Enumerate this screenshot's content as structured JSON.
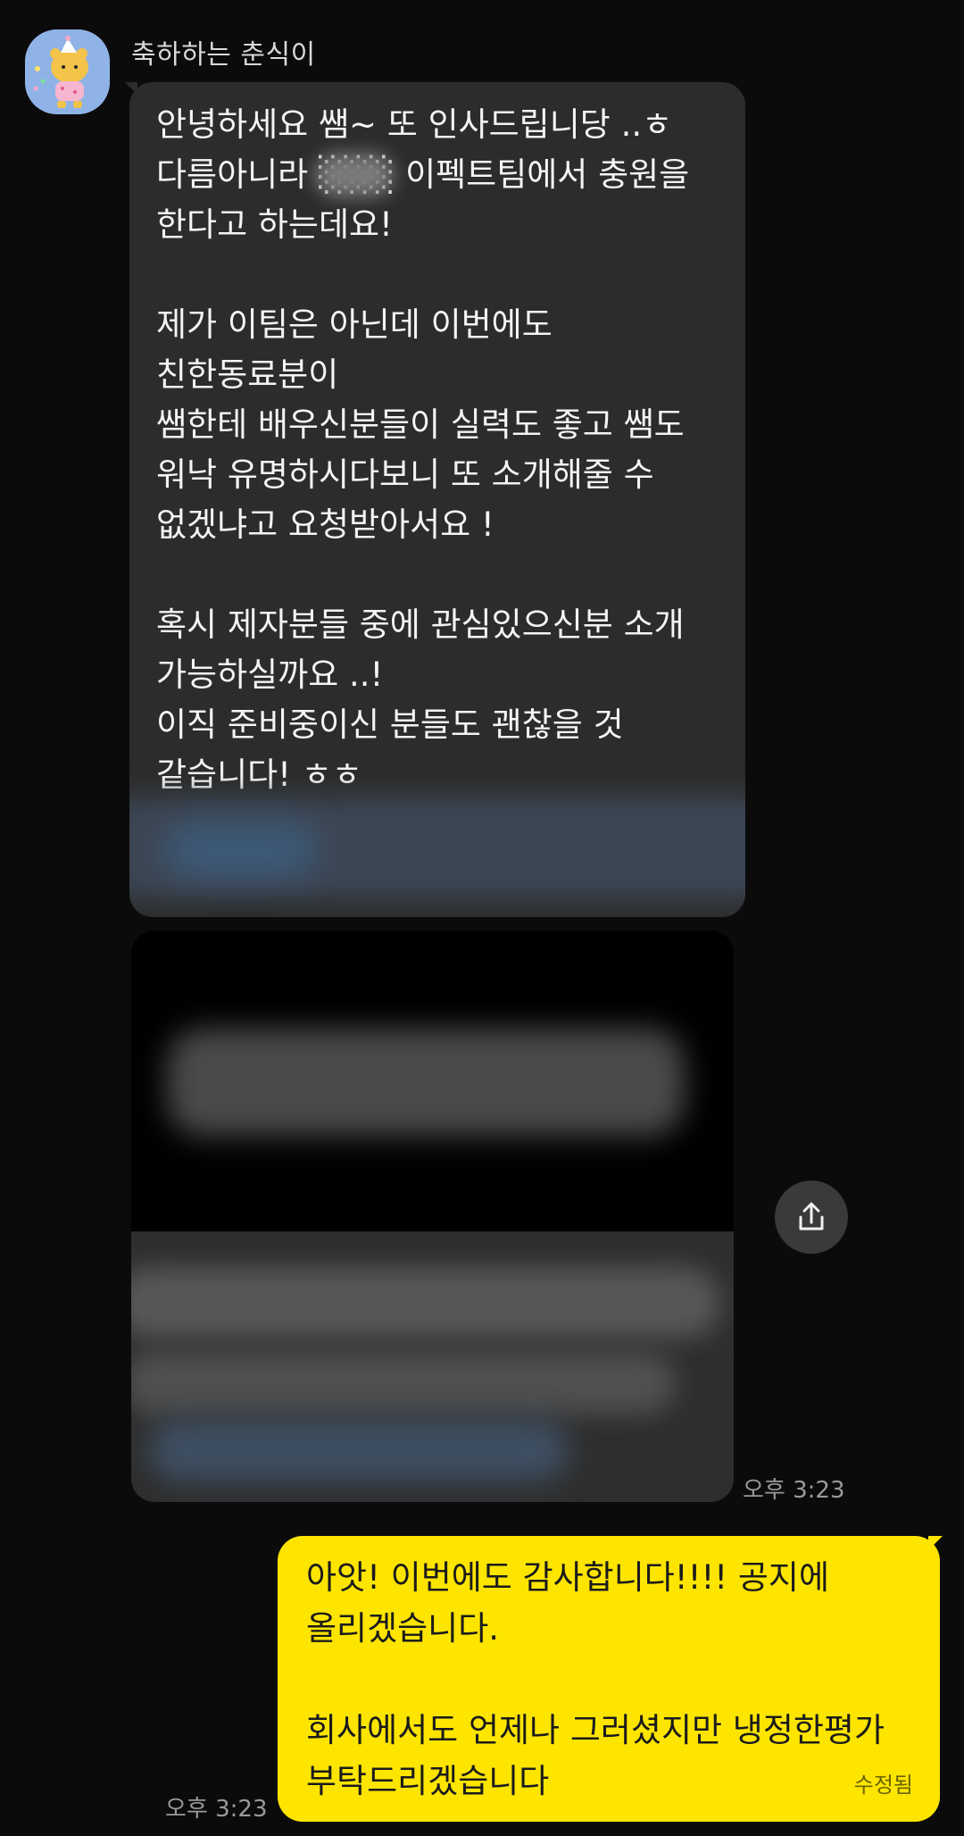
{
  "chat": {
    "sender_name": "축하하는 춘식이",
    "incoming_message": "안녕하세요 쌤~ 또 인사드립니당 ..ㅎ\n다름아니라 ░░░ 이펙트팀에서 충원을\n한다고 하는데요!\n\n제가 이팀은 아닌데 이번에도\n친한동료분이\n쌤한테 배우신분들이 실력도 좋고 쌤도\n워낙 유명하시다보니 또 소개해줄 수\n없겠냐고 요청받아서요 !\n\n혹시 제자분들 중에 관심있으신분 소개\n가능하실까요 ..!\n이직 준비중이신 분들도 괜찮을 것\n같습니다! ㅎㅎ",
    "incoming_time": "오후 3:23",
    "outgoing_message": "아앗! 이번에도 감사합니다!!!! 공지에\n올리겠습니다.\n\n회사에서도 언제나 그러셨지만 냉정한평가\n부탁드리겠습니다",
    "outgoing_time": "오후 3:23",
    "edited_label": "수정됨"
  },
  "colors": {
    "background": "#0b0b0b",
    "incoming_bubble": "#2c2c2c",
    "outgoing_bubble": "#fee500",
    "timestamp": "#9a9a9a"
  },
  "icons": {
    "avatar": "character-avatar-icon",
    "share": "share-icon"
  }
}
